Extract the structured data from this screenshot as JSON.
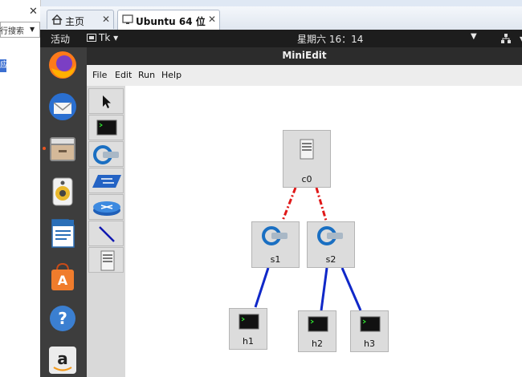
{
  "host": {
    "search_label": "行搜索",
    "selected_text": "应"
  },
  "tabs": [
    {
      "label": "主页"
    },
    {
      "label": "Ubuntu 64 位"
    }
  ],
  "gnome_panel": {
    "activities": "活动",
    "app_menu": "Tk ▾",
    "clock": "星期六 16：14"
  },
  "window": {
    "title": "MiniEdit"
  },
  "menu": [
    "File",
    "Edit",
    "Run",
    "Help"
  ],
  "toolbox": {
    "tools": [
      "select-tool",
      "host-tool",
      "switch-tool",
      "legacy-switch-tool",
      "router-tool",
      "link-tool",
      "controller-tool"
    ]
  },
  "dock": {
    "apps": [
      "firefox-icon",
      "thunderbird-icon",
      "files-icon",
      "rhythmbox-icon",
      "libreoffice-writer-icon",
      "software-center-icon",
      "help-icon",
      "amazon-icon"
    ]
  },
  "topology": {
    "nodes": [
      {
        "id": "c0",
        "label": "c0",
        "kind": "controller"
      },
      {
        "id": "s1",
        "label": "s1",
        "kind": "switch"
      },
      {
        "id": "s2",
        "label": "s2",
        "kind": "switch"
      },
      {
        "id": "h1",
        "label": "h1",
        "kind": "host"
      },
      {
        "id": "h2",
        "label": "h2",
        "kind": "host"
      },
      {
        "id": "h3",
        "label": "h3",
        "kind": "host"
      }
    ],
    "links": [
      {
        "from": "c0",
        "to": "s1",
        "type": "control",
        "color": "#e01818"
      },
      {
        "from": "c0",
        "to": "s2",
        "type": "control",
        "color": "#e01818"
      },
      {
        "from": "s1",
        "to": "h1",
        "type": "data",
        "color": "#1028c8"
      },
      {
        "from": "s2",
        "to": "h2",
        "type": "data",
        "color": "#1028c8"
      },
      {
        "from": "s2",
        "to": "h3",
        "type": "data",
        "color": "#1028c8"
      }
    ]
  }
}
